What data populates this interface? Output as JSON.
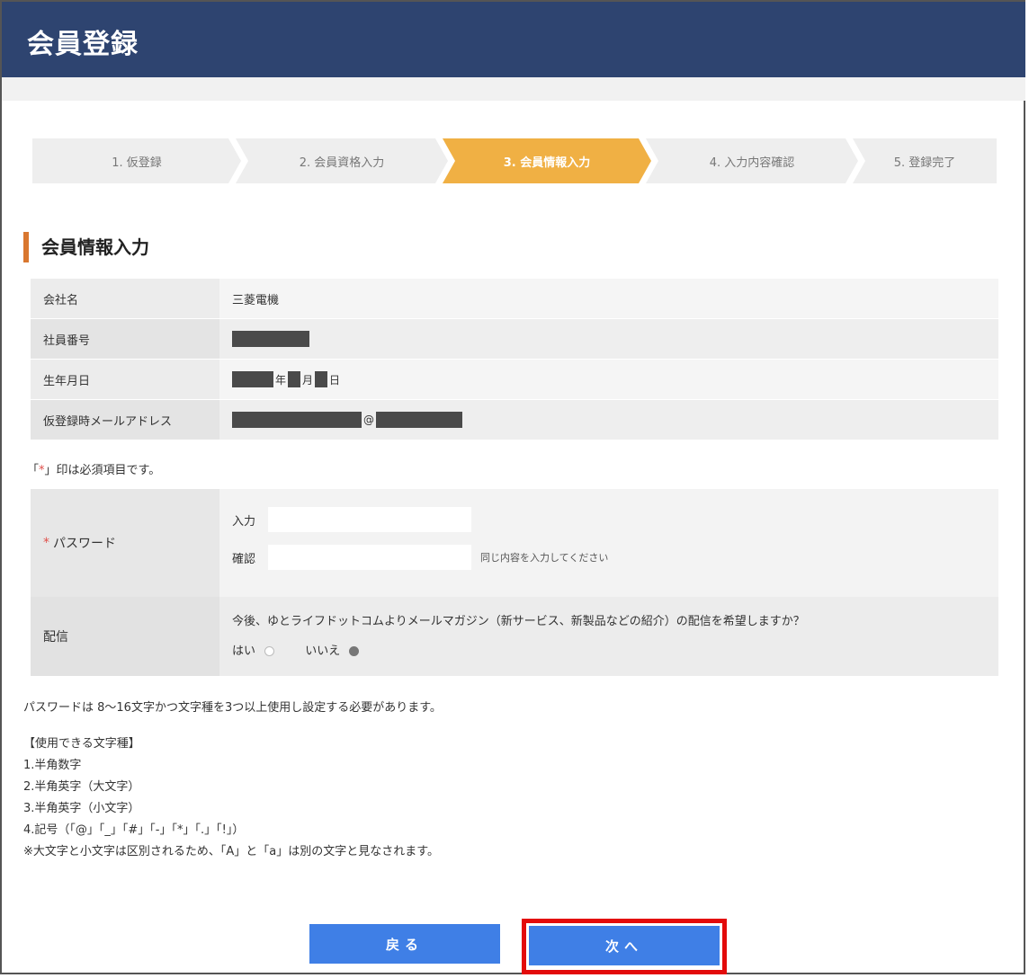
{
  "header": {
    "title": "会員登録"
  },
  "steps": [
    {
      "label": "1. 仮登録"
    },
    {
      "label": "2. 会員資格入力"
    },
    {
      "label": "3. 会員情報入力"
    },
    {
      "label": "4. 入力内容確認"
    },
    {
      "label": "5. 登録完了"
    }
  ],
  "active_step": 3,
  "section_title": "会員情報入力",
  "info": {
    "company_label": "会社名",
    "company_value": "三菱電機",
    "employee_label": "社員番号",
    "birth_label": "生年月日",
    "birth_year": "年",
    "birth_month": "月",
    "birth_day": "日",
    "email_label": "仮登録時メールアドレス",
    "email_at": "@"
  },
  "required_note": {
    "open": "「",
    "mark": "*",
    "close": "」印は必須項目です。"
  },
  "form": {
    "password_label": "パスワード",
    "password_required": "*",
    "input_label": "入力",
    "confirm_label": "確認",
    "confirm_hint": "同じ内容を入力してください",
    "delivery_label": "配信",
    "delivery_question": "今後、ゆとライフドットコムよりメールマガジン（新サービス、新製品などの紹介）の配信を希望しますか？",
    "yes_label": "はい",
    "no_label": "いいえ",
    "selected": "no"
  },
  "rules": {
    "lead": "パスワードは 8～16文字かつ文字種を3つ以上使用し設定する必要があります。",
    "heading": "【使用できる文字種】",
    "items": [
      "1.半角数字",
      "2.半角英字（大文字）",
      "3.半角英字（小文字）",
      "4.記号（「@」「_」「#」「-」「*」「.」「!」）"
    ],
    "note": "※大文字と小文字は区別されるため、「A」と「a」は別の文字と見なされます。"
  },
  "buttons": {
    "back": "戻る",
    "next": "次へ"
  },
  "colors": {
    "header": "#2e4470",
    "active_step": "#f0b044",
    "button": "#3f7fe6",
    "highlight": "#e30b0b",
    "accent": "#d9772f"
  }
}
